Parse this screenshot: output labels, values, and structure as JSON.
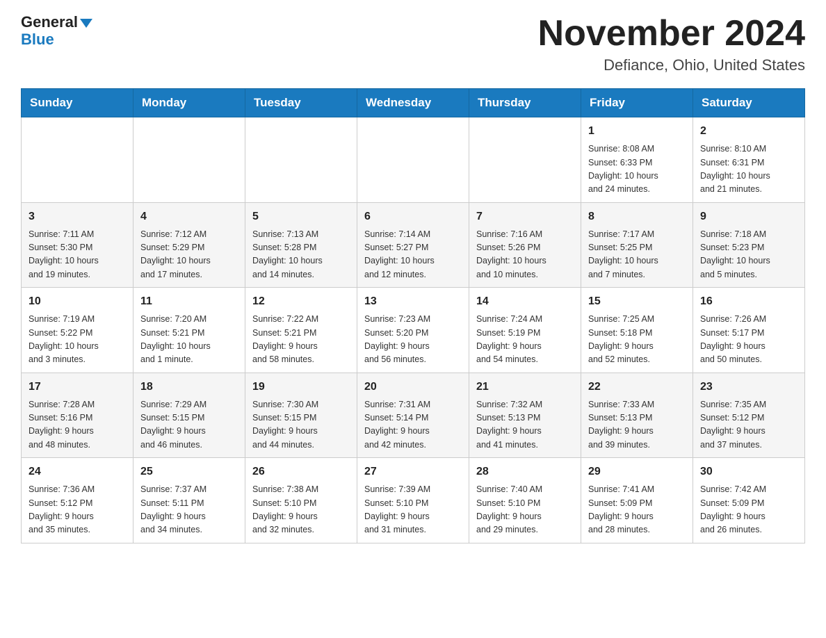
{
  "header": {
    "logo_line1": "General",
    "logo_line2": "Blue",
    "month_title": "November 2024",
    "location": "Defiance, Ohio, United States"
  },
  "days_of_week": [
    "Sunday",
    "Monday",
    "Tuesday",
    "Wednesday",
    "Thursday",
    "Friday",
    "Saturday"
  ],
  "weeks": [
    [
      {
        "day": "",
        "info": ""
      },
      {
        "day": "",
        "info": ""
      },
      {
        "day": "",
        "info": ""
      },
      {
        "day": "",
        "info": ""
      },
      {
        "day": "",
        "info": ""
      },
      {
        "day": "1",
        "info": "Sunrise: 8:08 AM\nSunset: 6:33 PM\nDaylight: 10 hours\nand 24 minutes."
      },
      {
        "day": "2",
        "info": "Sunrise: 8:10 AM\nSunset: 6:31 PM\nDaylight: 10 hours\nand 21 minutes."
      }
    ],
    [
      {
        "day": "3",
        "info": "Sunrise: 7:11 AM\nSunset: 5:30 PM\nDaylight: 10 hours\nand 19 minutes."
      },
      {
        "day": "4",
        "info": "Sunrise: 7:12 AM\nSunset: 5:29 PM\nDaylight: 10 hours\nand 17 minutes."
      },
      {
        "day": "5",
        "info": "Sunrise: 7:13 AM\nSunset: 5:28 PM\nDaylight: 10 hours\nand 14 minutes."
      },
      {
        "day": "6",
        "info": "Sunrise: 7:14 AM\nSunset: 5:27 PM\nDaylight: 10 hours\nand 12 minutes."
      },
      {
        "day": "7",
        "info": "Sunrise: 7:16 AM\nSunset: 5:26 PM\nDaylight: 10 hours\nand 10 minutes."
      },
      {
        "day": "8",
        "info": "Sunrise: 7:17 AM\nSunset: 5:25 PM\nDaylight: 10 hours\nand 7 minutes."
      },
      {
        "day": "9",
        "info": "Sunrise: 7:18 AM\nSunset: 5:23 PM\nDaylight: 10 hours\nand 5 minutes."
      }
    ],
    [
      {
        "day": "10",
        "info": "Sunrise: 7:19 AM\nSunset: 5:22 PM\nDaylight: 10 hours\nand 3 minutes."
      },
      {
        "day": "11",
        "info": "Sunrise: 7:20 AM\nSunset: 5:21 PM\nDaylight: 10 hours\nand 1 minute."
      },
      {
        "day": "12",
        "info": "Sunrise: 7:22 AM\nSunset: 5:21 PM\nDaylight: 9 hours\nand 58 minutes."
      },
      {
        "day": "13",
        "info": "Sunrise: 7:23 AM\nSunset: 5:20 PM\nDaylight: 9 hours\nand 56 minutes."
      },
      {
        "day": "14",
        "info": "Sunrise: 7:24 AM\nSunset: 5:19 PM\nDaylight: 9 hours\nand 54 minutes."
      },
      {
        "day": "15",
        "info": "Sunrise: 7:25 AM\nSunset: 5:18 PM\nDaylight: 9 hours\nand 52 minutes."
      },
      {
        "day": "16",
        "info": "Sunrise: 7:26 AM\nSunset: 5:17 PM\nDaylight: 9 hours\nand 50 minutes."
      }
    ],
    [
      {
        "day": "17",
        "info": "Sunrise: 7:28 AM\nSunset: 5:16 PM\nDaylight: 9 hours\nand 48 minutes."
      },
      {
        "day": "18",
        "info": "Sunrise: 7:29 AM\nSunset: 5:15 PM\nDaylight: 9 hours\nand 46 minutes."
      },
      {
        "day": "19",
        "info": "Sunrise: 7:30 AM\nSunset: 5:15 PM\nDaylight: 9 hours\nand 44 minutes."
      },
      {
        "day": "20",
        "info": "Sunrise: 7:31 AM\nSunset: 5:14 PM\nDaylight: 9 hours\nand 42 minutes."
      },
      {
        "day": "21",
        "info": "Sunrise: 7:32 AM\nSunset: 5:13 PM\nDaylight: 9 hours\nand 41 minutes."
      },
      {
        "day": "22",
        "info": "Sunrise: 7:33 AM\nSunset: 5:13 PM\nDaylight: 9 hours\nand 39 minutes."
      },
      {
        "day": "23",
        "info": "Sunrise: 7:35 AM\nSunset: 5:12 PM\nDaylight: 9 hours\nand 37 minutes."
      }
    ],
    [
      {
        "day": "24",
        "info": "Sunrise: 7:36 AM\nSunset: 5:12 PM\nDaylight: 9 hours\nand 35 minutes."
      },
      {
        "day": "25",
        "info": "Sunrise: 7:37 AM\nSunset: 5:11 PM\nDaylight: 9 hours\nand 34 minutes."
      },
      {
        "day": "26",
        "info": "Sunrise: 7:38 AM\nSunset: 5:10 PM\nDaylight: 9 hours\nand 32 minutes."
      },
      {
        "day": "27",
        "info": "Sunrise: 7:39 AM\nSunset: 5:10 PM\nDaylight: 9 hours\nand 31 minutes."
      },
      {
        "day": "28",
        "info": "Sunrise: 7:40 AM\nSunset: 5:10 PM\nDaylight: 9 hours\nand 29 minutes."
      },
      {
        "day": "29",
        "info": "Sunrise: 7:41 AM\nSunset: 5:09 PM\nDaylight: 9 hours\nand 28 minutes."
      },
      {
        "day": "30",
        "info": "Sunrise: 7:42 AM\nSunset: 5:09 PM\nDaylight: 9 hours\nand 26 minutes."
      }
    ]
  ]
}
